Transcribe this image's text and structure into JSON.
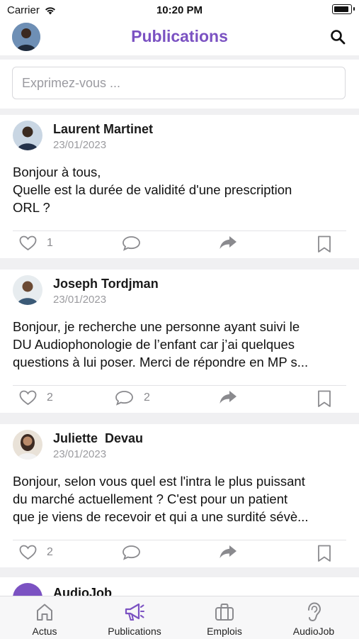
{
  "status_bar": {
    "carrier": "Carrier",
    "time": "10:20 PM"
  },
  "header": {
    "title": "Publications"
  },
  "compose": {
    "placeholder": "Exprimez-vous ..."
  },
  "posts": [
    {
      "author": "Laurent Martinet",
      "date": "23/01/2023",
      "body_lines": [
        "Bonjour à tous,",
        "Quelle est la durée de validité d'une prescription",
        "ORL ?"
      ],
      "likes": "1",
      "comments": ""
    },
    {
      "author": "Joseph Tordjman",
      "date": "23/01/2023",
      "body_lines": [
        "Bonjour, je recherche une personne ayant suivi le",
        "DU Audiophonologie de l’enfant car j’ai quelques",
        "questions à lui poser. Merci de répondre en MP s..."
      ],
      "likes": "2",
      "comments": "2"
    },
    {
      "author": "Juliette  Devau",
      "date": "23/01/2023",
      "body_lines": [
        "Bonjour, selon vous quel est l'intra le plus puissant",
        "du marché actuellement ? C'est pour un patient",
        "que je viens de recevoir et qui a une surdité sévè..."
      ],
      "likes": "2",
      "comments": ""
    }
  ],
  "partial_post": {
    "author": "AudioJob"
  },
  "tabs": [
    {
      "label": "Actus",
      "icon": "home-icon",
      "active": false
    },
    {
      "label": "Publications",
      "icon": "megaphone-icon",
      "active": true
    },
    {
      "label": "Emplois",
      "icon": "briefcase-icon",
      "active": false
    },
    {
      "label": "AudioJob",
      "icon": "ear-icon",
      "active": false
    }
  ],
  "colors": {
    "accent": "#7b52c2",
    "icon_gray": "#8a8a8e",
    "band": "#f0f0f2"
  }
}
